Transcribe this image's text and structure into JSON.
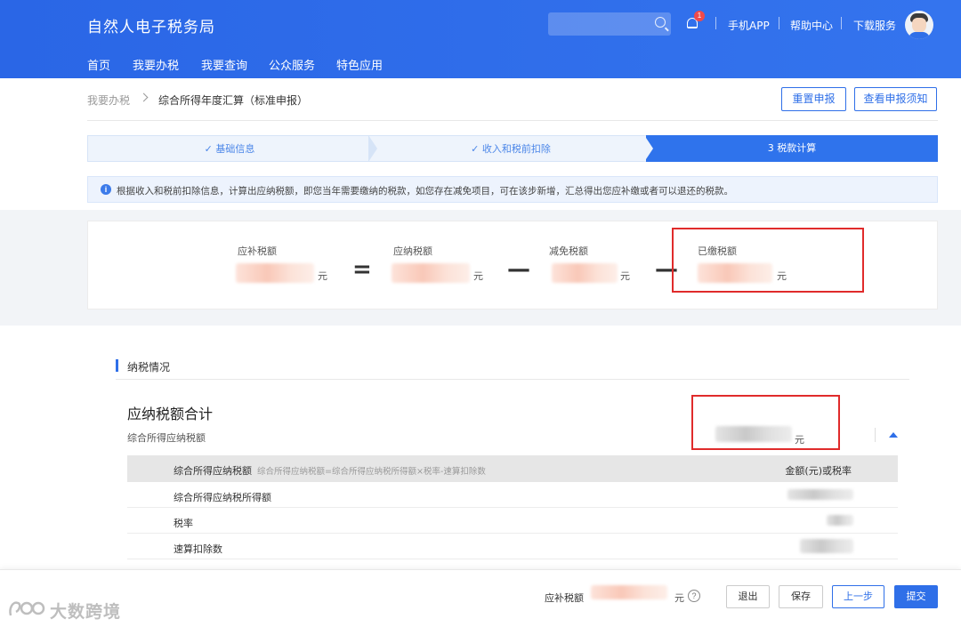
{
  "header": {
    "title": "自然人电子税务局",
    "search_placeholder": "",
    "notification_count": "1",
    "links": [
      "手机APP",
      "帮助中心",
      "下载服务"
    ],
    "nav": [
      "首页",
      "我要办税",
      "我要查询",
      "公众服务",
      "特色应用"
    ]
  },
  "breadcrumb": {
    "parent": "我要办税",
    "current": "综合所得年度汇算（标准申报）"
  },
  "actions": {
    "reset": "重置申报",
    "notice": "查看申报须知"
  },
  "steps": [
    {
      "label": "✓ 基础信息",
      "state": "done"
    },
    {
      "label": "✓ 收入和税前扣除",
      "state": "done"
    },
    {
      "label": "3 税款计算",
      "state": "active"
    }
  ],
  "info_text": "根据收入和税前扣除信息，计算出应纳税额，即您当年需要缴纳的税款，如您存在减免项目，可在该步新增，汇总得出您应补缴或者可以退还的税款。",
  "formula": {
    "items": [
      {
        "label": "应补税额",
        "unit": "元"
      },
      {
        "label": "应纳税额",
        "unit": "元"
      },
      {
        "label": "减免税额",
        "unit": "元"
      },
      {
        "label": "已缴税额",
        "unit": "元"
      }
    ],
    "operators": [
      "=",
      "—",
      "—"
    ]
  },
  "section": {
    "title": "纳税情况",
    "card_title": "应纳税额合计",
    "card_subtitle": "综合所得应纳税额",
    "card_unit": "元"
  },
  "table": {
    "header_label": "综合所得应纳税额",
    "header_note": "综合所得应纳税额=综合所得应纳税所得额×税率-速算扣除数",
    "header_right": "金额(元)或税率",
    "rows": [
      "综合所得应纳税所得额",
      "税率",
      "速算扣除数"
    ]
  },
  "footer": {
    "label": "应补税额",
    "unit": "元",
    "buttons": [
      "退出",
      "保存",
      "上一步",
      "提交"
    ]
  },
  "watermark": "大数跨境",
  "colors": {
    "primary": "#2f6fe8",
    "highlight_box": "#e02b2b"
  }
}
